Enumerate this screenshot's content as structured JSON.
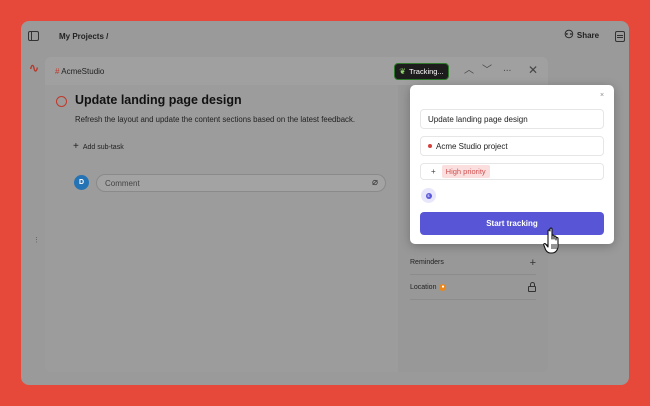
{
  "topbar": {
    "breadcrumb": "My Projects /",
    "share_label": "Share"
  },
  "modal": {
    "project_tag": "AcmeStudio",
    "tracking_label": "Tracking...",
    "task": {
      "title": "Update landing page design",
      "description": "Refresh the layout and update the content sections based on the latest feedback."
    },
    "add_subtask_label": "Add sub-task",
    "comment": {
      "avatar_initial": "D",
      "placeholder": "Comment"
    },
    "right_panel": {
      "reminders_label": "Reminders",
      "location_label": "Location"
    }
  },
  "popover": {
    "close_glyph": "×",
    "task_name": "Update landing page design",
    "project_name": "Acme Studio project",
    "priority_label": "High priority",
    "start_button_label": "Start tracking"
  },
  "colors": {
    "background": "#e6493a",
    "accent": "#5856d6",
    "priority_red": "#d6403a",
    "avatar_blue": "#2474b5"
  },
  "icons": [
    "sidebar-toggle-icon",
    "share-icon",
    "panel-icon",
    "app-logo-icon",
    "leaf-icon",
    "chevron-up-icon",
    "chevron-down-icon",
    "more-icon",
    "close-icon",
    "paperclip-icon",
    "plus-icon",
    "lock-icon",
    "location-icon",
    "hand-cursor-icon"
  ]
}
